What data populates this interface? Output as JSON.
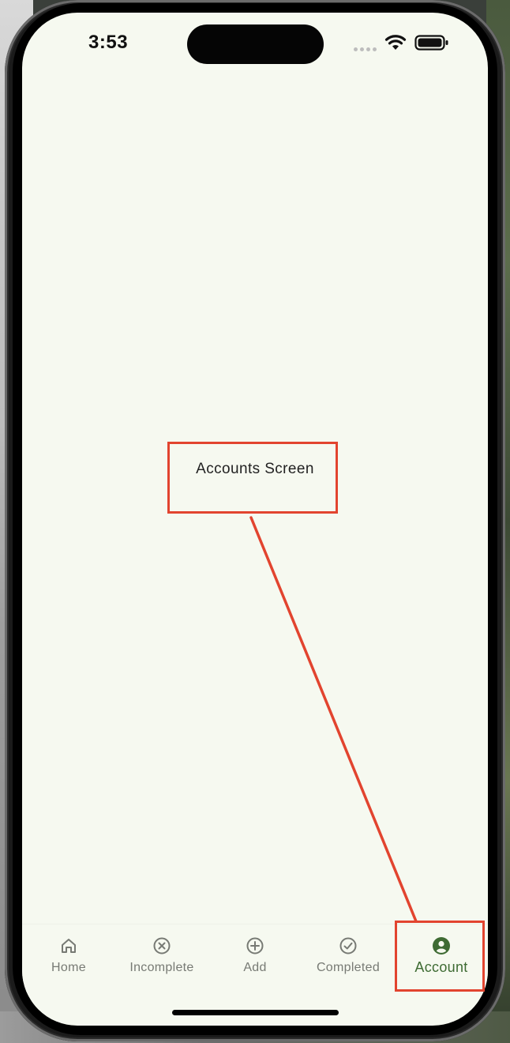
{
  "status_bar": {
    "time": "3:53"
  },
  "main": {
    "center_text": "Accounts Screen"
  },
  "tab_bar": {
    "items": [
      {
        "label": "Home",
        "icon": "home-icon",
        "active": false
      },
      {
        "label": "Incomplete",
        "icon": "circle-x-icon",
        "active": false
      },
      {
        "label": "Add",
        "icon": "circle-plus-icon",
        "active": false
      },
      {
        "label": "Completed",
        "icon": "circle-check-icon",
        "active": false
      },
      {
        "label": "Account",
        "icon": "account-circle-icon",
        "active": true
      }
    ]
  },
  "colors": {
    "background": "#f6f9f0",
    "active_tab": "#3e6b33",
    "inactive_tab": "#777a74",
    "annotation": "#e2442f"
  }
}
